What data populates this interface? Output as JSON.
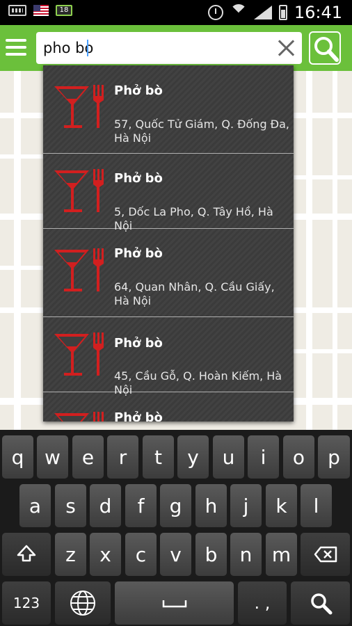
{
  "status_bar": {
    "time": "16:41",
    "notification_badge": "18"
  },
  "search": {
    "query": "pho bo"
  },
  "suggestions": [
    {
      "title": "Phở bò",
      "address": "57, Quốc Tử Giám, Q. Đống Đa, Hà Nội"
    },
    {
      "title": "Phở bò",
      "address": "5, Dốc La Pho, Q. Tây Hồ, Hà Nội"
    },
    {
      "title": "Phở bò",
      "address": "64, Quan Nhân, Q. Cầu Giấy, Hà Nội"
    },
    {
      "title": "Phở bò",
      "address": "45, Cầu Gỗ, Q. Hoàn Kiếm, Hà Nội"
    },
    {
      "title": "Phở bò",
      "address": ""
    }
  ],
  "keyboard": {
    "row1": [
      "q",
      "w",
      "e",
      "r",
      "t",
      "y",
      "u",
      "i",
      "o",
      "p"
    ],
    "row2": [
      "a",
      "s",
      "d",
      "f",
      "g",
      "h",
      "j",
      "k",
      "l"
    ],
    "row3": [
      "z",
      "x",
      "c",
      "v",
      "b",
      "n",
      "m"
    ],
    "numbers_key": "123",
    "punct_key": ". ,"
  },
  "colors": {
    "accent_green": "#6bc03b",
    "restaurant_icon_red": "#d21f1f",
    "dropdown_bg": "#3e3e3e",
    "keyboard_bg": "#1b1b1b"
  },
  "icons": [
    "keyboard-icon",
    "us-flag-icon",
    "alarm-icon",
    "wifi-icon",
    "signal-icon",
    "battery-icon",
    "menu-icon",
    "clear-icon",
    "search-icon",
    "restaurant-icon",
    "shift-icon",
    "backspace-icon",
    "globe-icon",
    "space-icon"
  ]
}
